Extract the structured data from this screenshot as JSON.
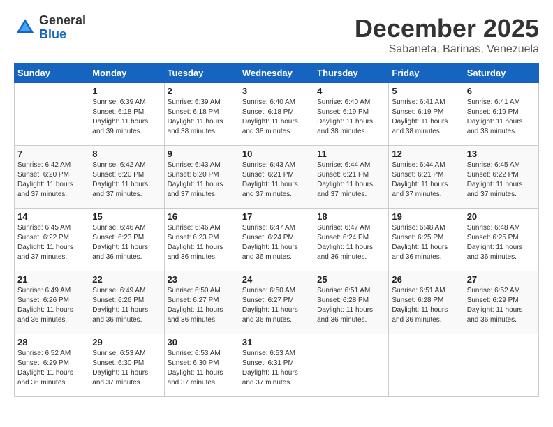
{
  "logo": {
    "general": "General",
    "blue": "Blue"
  },
  "title": {
    "month_year": "December 2025",
    "location": "Sabaneta, Barinas, Venezuela"
  },
  "days_of_week": [
    "Sunday",
    "Monday",
    "Tuesday",
    "Wednesday",
    "Thursday",
    "Friday",
    "Saturday"
  ],
  "weeks": [
    [
      {
        "day": "",
        "detail": ""
      },
      {
        "day": "1",
        "detail": "Sunrise: 6:39 AM\nSunset: 6:18 PM\nDaylight: 11 hours\nand 39 minutes."
      },
      {
        "day": "2",
        "detail": "Sunrise: 6:39 AM\nSunset: 6:18 PM\nDaylight: 11 hours\nand 38 minutes."
      },
      {
        "day": "3",
        "detail": "Sunrise: 6:40 AM\nSunset: 6:18 PM\nDaylight: 11 hours\nand 38 minutes."
      },
      {
        "day": "4",
        "detail": "Sunrise: 6:40 AM\nSunset: 6:19 PM\nDaylight: 11 hours\nand 38 minutes."
      },
      {
        "day": "5",
        "detail": "Sunrise: 6:41 AM\nSunset: 6:19 PM\nDaylight: 11 hours\nand 38 minutes."
      },
      {
        "day": "6",
        "detail": "Sunrise: 6:41 AM\nSunset: 6:19 PM\nDaylight: 11 hours\nand 38 minutes."
      }
    ],
    [
      {
        "day": "7",
        "detail": "Sunrise: 6:42 AM\nSunset: 6:20 PM\nDaylight: 11 hours\nand 37 minutes."
      },
      {
        "day": "8",
        "detail": "Sunrise: 6:42 AM\nSunset: 6:20 PM\nDaylight: 11 hours\nand 37 minutes."
      },
      {
        "day": "9",
        "detail": "Sunrise: 6:43 AM\nSunset: 6:20 PM\nDaylight: 11 hours\nand 37 minutes."
      },
      {
        "day": "10",
        "detail": "Sunrise: 6:43 AM\nSunset: 6:21 PM\nDaylight: 11 hours\nand 37 minutes."
      },
      {
        "day": "11",
        "detail": "Sunrise: 6:44 AM\nSunset: 6:21 PM\nDaylight: 11 hours\nand 37 minutes."
      },
      {
        "day": "12",
        "detail": "Sunrise: 6:44 AM\nSunset: 6:21 PM\nDaylight: 11 hours\nand 37 minutes."
      },
      {
        "day": "13",
        "detail": "Sunrise: 6:45 AM\nSunset: 6:22 PM\nDaylight: 11 hours\nand 37 minutes."
      }
    ],
    [
      {
        "day": "14",
        "detail": "Sunrise: 6:45 AM\nSunset: 6:22 PM\nDaylight: 11 hours\nand 37 minutes."
      },
      {
        "day": "15",
        "detail": "Sunrise: 6:46 AM\nSunset: 6:23 PM\nDaylight: 11 hours\nand 36 minutes."
      },
      {
        "day": "16",
        "detail": "Sunrise: 6:46 AM\nSunset: 6:23 PM\nDaylight: 11 hours\nand 36 minutes."
      },
      {
        "day": "17",
        "detail": "Sunrise: 6:47 AM\nSunset: 6:24 PM\nDaylight: 11 hours\nand 36 minutes."
      },
      {
        "day": "18",
        "detail": "Sunrise: 6:47 AM\nSunset: 6:24 PM\nDaylight: 11 hours\nand 36 minutes."
      },
      {
        "day": "19",
        "detail": "Sunrise: 6:48 AM\nSunset: 6:25 PM\nDaylight: 11 hours\nand 36 minutes."
      },
      {
        "day": "20",
        "detail": "Sunrise: 6:48 AM\nSunset: 6:25 PM\nDaylight: 11 hours\nand 36 minutes."
      }
    ],
    [
      {
        "day": "21",
        "detail": "Sunrise: 6:49 AM\nSunset: 6:26 PM\nDaylight: 11 hours\nand 36 minutes."
      },
      {
        "day": "22",
        "detail": "Sunrise: 6:49 AM\nSunset: 6:26 PM\nDaylight: 11 hours\nand 36 minutes."
      },
      {
        "day": "23",
        "detail": "Sunrise: 6:50 AM\nSunset: 6:27 PM\nDaylight: 11 hours\nand 36 minutes."
      },
      {
        "day": "24",
        "detail": "Sunrise: 6:50 AM\nSunset: 6:27 PM\nDaylight: 11 hours\nand 36 minutes."
      },
      {
        "day": "25",
        "detail": "Sunrise: 6:51 AM\nSunset: 6:28 PM\nDaylight: 11 hours\nand 36 minutes."
      },
      {
        "day": "26",
        "detail": "Sunrise: 6:51 AM\nSunset: 6:28 PM\nDaylight: 11 hours\nand 36 minutes."
      },
      {
        "day": "27",
        "detail": "Sunrise: 6:52 AM\nSunset: 6:29 PM\nDaylight: 11 hours\nand 36 minutes."
      }
    ],
    [
      {
        "day": "28",
        "detail": "Sunrise: 6:52 AM\nSunset: 6:29 PM\nDaylight: 11 hours\nand 36 minutes."
      },
      {
        "day": "29",
        "detail": "Sunrise: 6:53 AM\nSunset: 6:30 PM\nDaylight: 11 hours\nand 37 minutes."
      },
      {
        "day": "30",
        "detail": "Sunrise: 6:53 AM\nSunset: 6:30 PM\nDaylight: 11 hours\nand 37 minutes."
      },
      {
        "day": "31",
        "detail": "Sunrise: 6:53 AM\nSunset: 6:31 PM\nDaylight: 11 hours\nand 37 minutes."
      },
      {
        "day": "",
        "detail": ""
      },
      {
        "day": "",
        "detail": ""
      },
      {
        "day": "",
        "detail": ""
      }
    ]
  ]
}
